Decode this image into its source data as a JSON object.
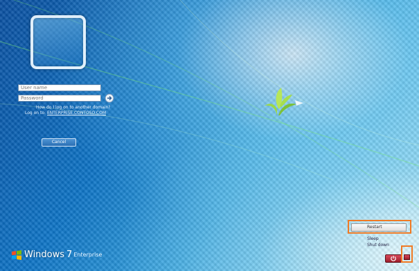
{
  "login": {
    "username_placeholder": "User name",
    "password_placeholder": "Password",
    "how_to_logon": "How do I log on to another domain?",
    "logon_to_prefix": "Log on to:",
    "logon_to_domain": "ENTERPRISE.CONTOSO.COM",
    "cancel_label": "Cancel"
  },
  "power_menu": {
    "restart": "Restart",
    "sleep": "Sleep",
    "shutdown": "Shut down"
  },
  "branding": {
    "product": "Windows",
    "version": "7",
    "edition": "Enterprise"
  },
  "colors": {
    "highlight": "#f07a24",
    "power_button": "#c0303f",
    "background": "#0b63ad"
  },
  "icons": {
    "submit": "arrow-right-icon",
    "logo": "windows-leaf-logo",
    "flag": "windows-flag-icon",
    "power": "power-icon"
  }
}
